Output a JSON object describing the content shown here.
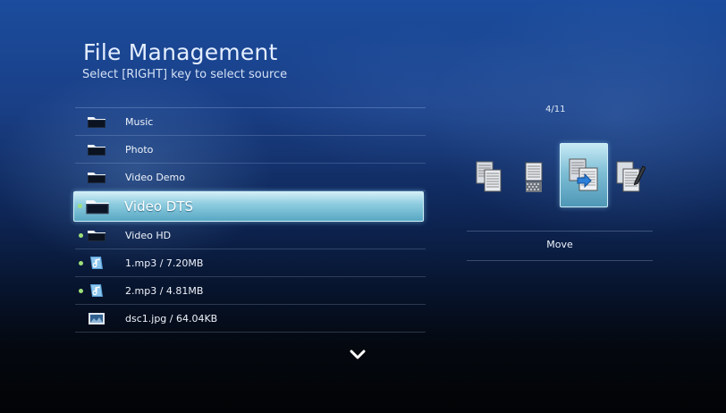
{
  "header": {
    "title": "File Management",
    "subtitle": "Select [RIGHT] key to select source"
  },
  "list": {
    "items": [
      {
        "label": "Music",
        "icon": "folder-icon",
        "marked": false
      },
      {
        "label": "Photo",
        "icon": "folder-icon",
        "marked": false
      },
      {
        "label": "Video Demo",
        "icon": "folder-icon",
        "marked": false
      },
      {
        "label": "Video DTS",
        "icon": "folder-icon",
        "marked": true,
        "selected": true
      },
      {
        "label": "Video HD",
        "icon": "folder-icon",
        "marked": true
      },
      {
        "label": "1.mp3 / 7.20MB",
        "icon": "music-file-icon",
        "marked": true
      },
      {
        "label": "2.mp3 / 4.81MB",
        "icon": "music-file-icon",
        "marked": true
      },
      {
        "label": "dsc1.jpg / 64.04KB",
        "icon": "image-file-icon",
        "marked": false
      }
    ],
    "scroll_icon": "chevron-down-icon"
  },
  "panel": {
    "page": "4/11",
    "tools": [
      {
        "icon": "copy-icon"
      },
      {
        "icon": "delete-icon"
      },
      {
        "icon": "move-icon",
        "selected": true
      },
      {
        "icon": "rename-icon"
      }
    ],
    "option_label": "Move"
  },
  "colors": {
    "selection": "#8fcde0",
    "marker": "#9fe07a",
    "background_top": "#1b4c9d",
    "background_bottom": "#020305"
  }
}
